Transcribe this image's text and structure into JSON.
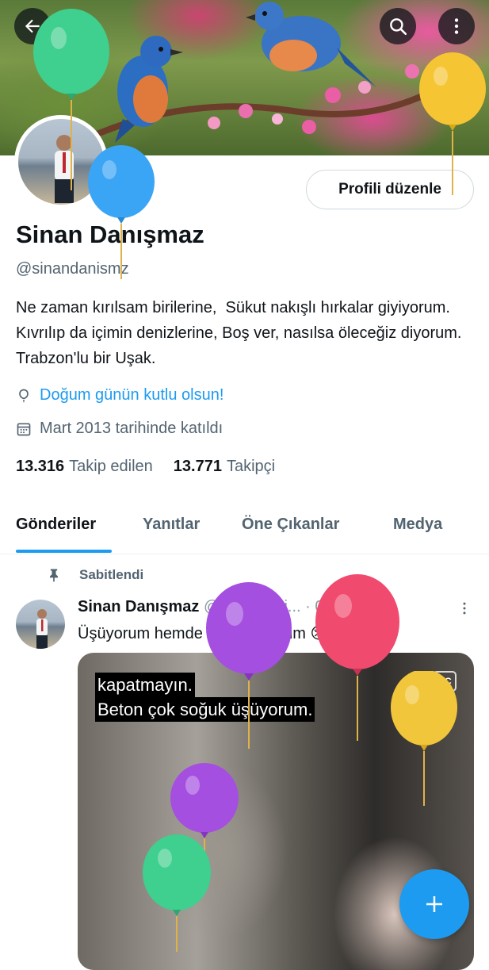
{
  "header": {
    "back_icon": "arrow-left-icon",
    "search_icon": "search-icon",
    "more_icon": "more-vertical-icon"
  },
  "profile": {
    "name": "Sinan Danışmaz",
    "handle": "@sinandanismz",
    "bio": "Ne zaman kırılsam birilerine,  Sükut nakışlı hırkalar giyiyorum.  Kıvrılıp da içimin denizlerine, Boş ver, nasılsa öleceğiz diyorum.     Trabzon'lu bir Uşak.",
    "edit_label": "Profili düzenle",
    "birthday_text": "Doğum günün kutlu olsun!",
    "joined_text": "Mart 2013 tarihinde katıldı",
    "following_count": "13.316",
    "following_label": "Takip edilen",
    "followers_count": "13.771",
    "followers_label": "Takipçi"
  },
  "tabs": [
    {
      "label": "Gönderiler",
      "active": true
    },
    {
      "label": "Yanıtlar",
      "active": false
    },
    {
      "label": "Öne Çıkanlar",
      "active": false
    },
    {
      "label": "Medya",
      "active": false
    }
  ],
  "pinned_post": {
    "pinned_label": "Sabitlendi",
    "author_name": "Sinan Danışmaz",
    "author_handle": "@sinandani...",
    "date": "· 08 Şub 23",
    "text": "Üşüyorum hemde çok üşüyorum 😢😭😪",
    "caption_lines": [
      "kapatmayın.",
      "Beton çok soğuk üşüyorum."
    ],
    "cc_label": "CC"
  },
  "colors": {
    "accent": "#1d9bf0",
    "text_primary": "#0f1419",
    "text_secondary": "#536471"
  }
}
